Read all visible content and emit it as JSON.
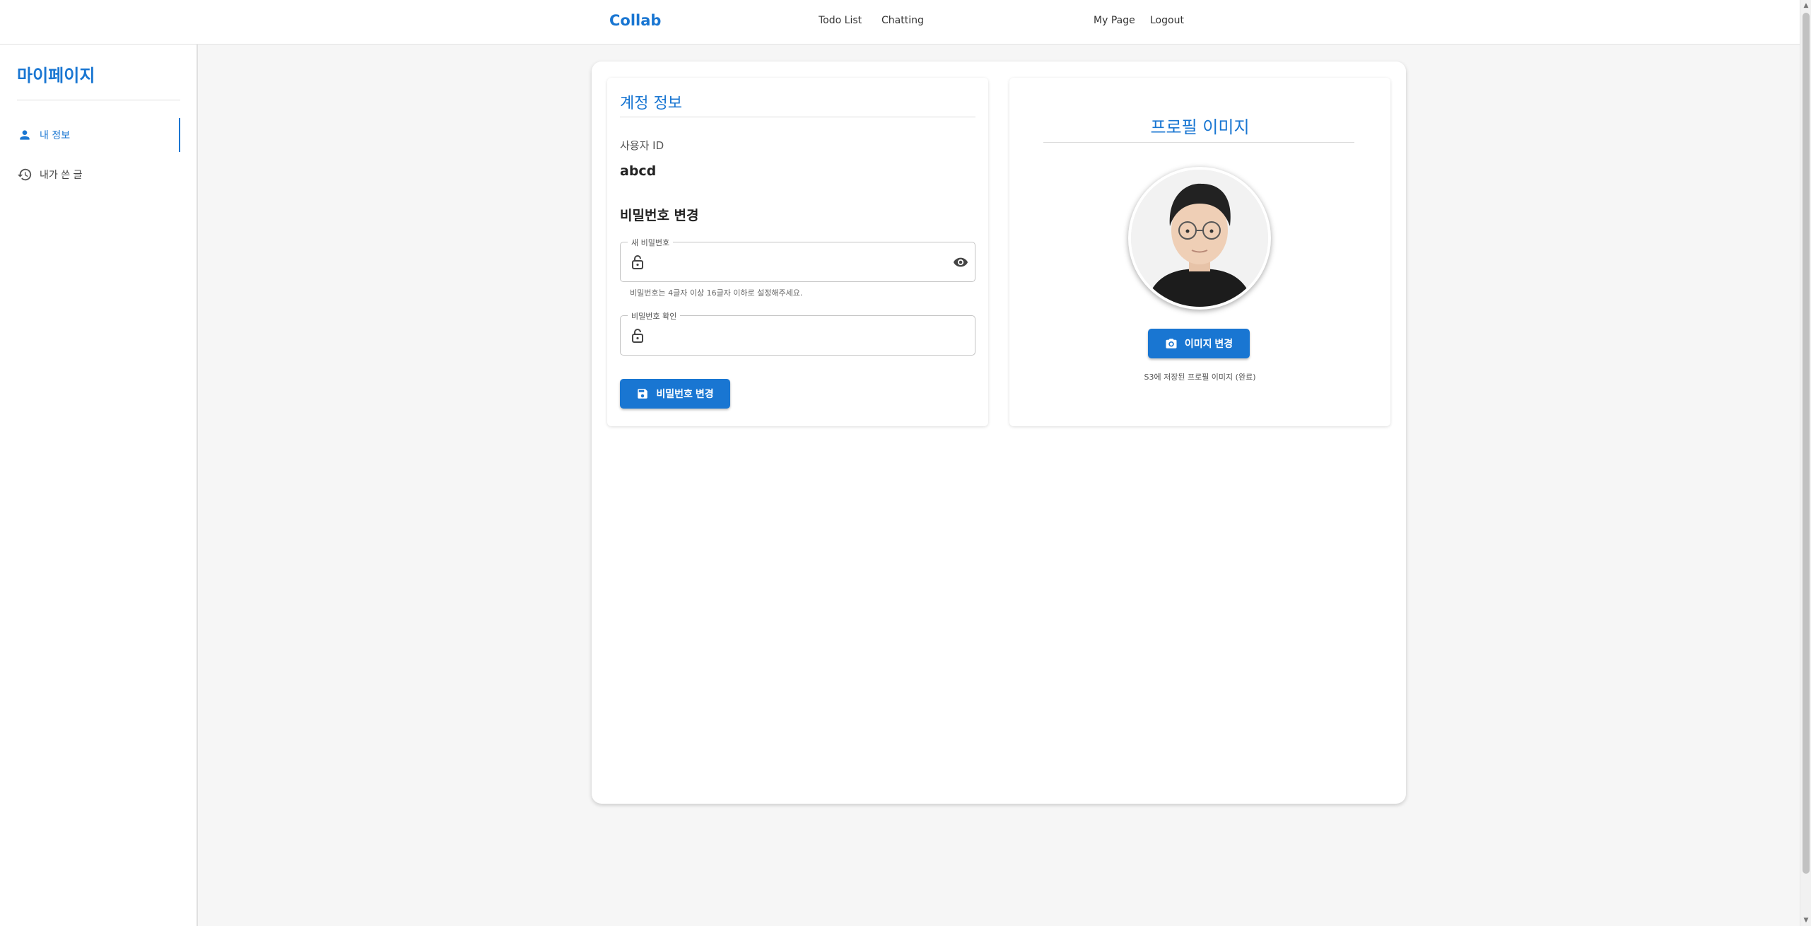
{
  "header": {
    "brand": "Collab",
    "nav": {
      "todo": "Todo List",
      "chatting": "Chatting",
      "mypage": "My Page",
      "logout": "Logout"
    }
  },
  "sidebar": {
    "title": "마이페이지",
    "items": [
      {
        "label": "내 정보",
        "icon": "person-icon",
        "active": true
      },
      {
        "label": "내가 쓴 글",
        "icon": "history-icon",
        "active": false
      }
    ]
  },
  "account": {
    "title": "계정 정보",
    "user_id_label": "사용자 ID",
    "user_id_value": "abcd",
    "password_section_title": "비밀번호 변경",
    "new_password_label": "새 비밀번호",
    "new_password_value": "",
    "new_password_helper": "비밀번호는 4글자 이상 16글자 이하로 설정해주세요.",
    "confirm_password_label": "비밀번호 확인",
    "confirm_password_value": "",
    "save_button": "비밀번호 변경"
  },
  "profile": {
    "title": "프로필 이미지",
    "change_button": "이미지 변경",
    "caption": "S3에 저장된 프로필 이미지 (완료)"
  },
  "colors": {
    "accent": "#1976d2",
    "background": "#f6f6f6"
  }
}
